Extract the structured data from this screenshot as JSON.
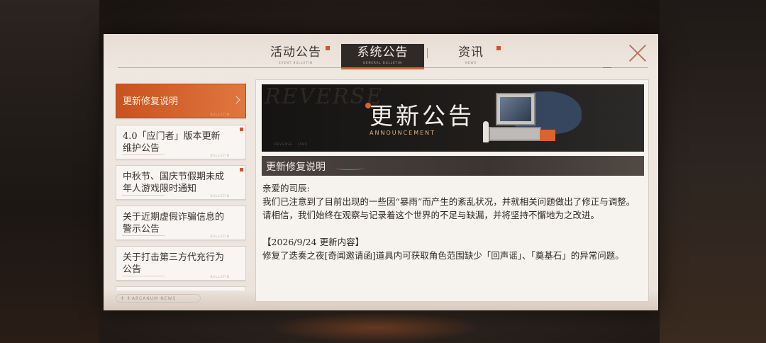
{
  "tabs": [
    {
      "label": "活动公告",
      "sub": "EVENT BULLETIN",
      "active": false,
      "dot": true
    },
    {
      "label": "系统公告",
      "sub": "GENERAL BULLETIN",
      "active": true,
      "dot": false
    },
    {
      "label": "资讯",
      "sub": "NEWS",
      "active": false,
      "dot": true
    }
  ],
  "sidebar": {
    "items": [
      {
        "title": "更新修复说明",
        "tag": "BULLETIN",
        "selected": true,
        "dot": false
      },
      {
        "title": "4.0「应门者」版本更新维护公告",
        "tag": "BULLETIN",
        "selected": false,
        "dot": true
      },
      {
        "title": "中秋节、国庆节假期未成年人游戏限时通知",
        "tag": "BULLETIN",
        "selected": false,
        "dot": true
      },
      {
        "title": "关于近期虚假诈骗信息的警示公告",
        "tag": "BULLETIN",
        "selected": false,
        "dot": false
      },
      {
        "title": "关于打击第三方代充行为公告",
        "tag": "BULLETIN",
        "selected": false,
        "dot": false
      }
    ],
    "footer": "ARCANUM NEWS"
  },
  "banner": {
    "ghost_text": "REVERSE",
    "title": "更新公告",
    "subtitle": "ANNOUNCEMENT",
    "tiny_left": "REVERSE · 1999",
    "tiny_right": "· · ·"
  },
  "article": {
    "heading": "更新修复说明",
    "greeting": "亲爱的司辰:",
    "paragraph": "我们已注意到了目前出现的一些因“暴雨”而产生的紊乱状况，并就相关问题做出了修正与调整。请相信，我们始终在观察与记录着这个世界的不足与缺漏，并将坚持不懈地为之改进。",
    "update_title": "【2026/9/24 更新内容】",
    "update_item": "修复了迭奏之夜[奇闻邀请函]道具内可获取角色范围缺少「回声谣」、「奠基石」的异常问题。"
  },
  "colors": {
    "accent": "#d9642f",
    "panel": "#ece4dc",
    "dark": "#2f2a28"
  },
  "icons": {
    "close": "close-icon",
    "chevron": "chevron-right-icon"
  }
}
